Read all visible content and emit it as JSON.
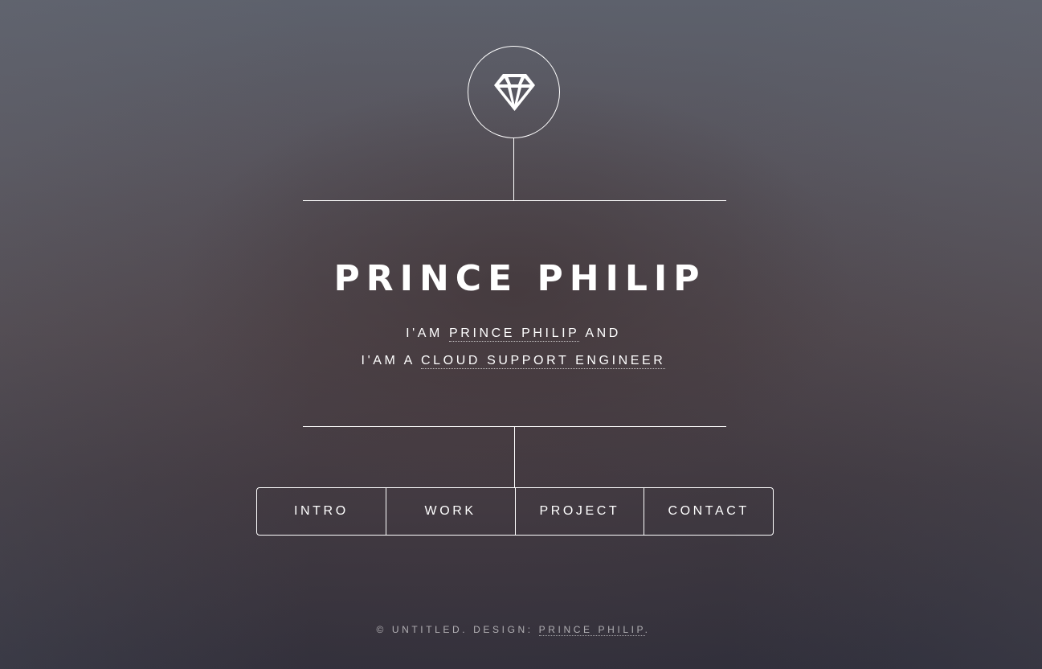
{
  "header": {
    "logo_icon": "diamond-icon"
  },
  "main": {
    "title": "PRINCE PHILIP",
    "line1": {
      "prefix": "I'AM",
      "link": "PRINCE PHILIP",
      "suffix": "AND"
    },
    "line2": {
      "prefix": "I'AM A",
      "link": "CLOUD SUPPORT ENGINEER"
    }
  },
  "nav": {
    "items": [
      {
        "label": "INTRO"
      },
      {
        "label": "WORK"
      },
      {
        "label": "PROJECT"
      },
      {
        "label": "CONTACT"
      }
    ]
  },
  "footer": {
    "copyright": "© UNTITLED. DESIGN:",
    "designer_link": "PRINCE PHILIP",
    "trailing": "."
  },
  "colors": {
    "text": "#ffffff",
    "background_top": "#5d616c",
    "background_bottom": "#2e2e3a"
  }
}
